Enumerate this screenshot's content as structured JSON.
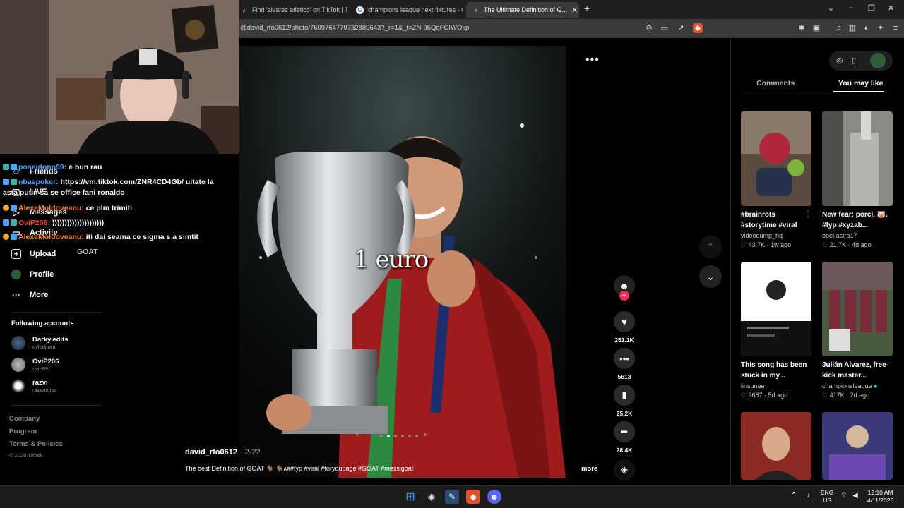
{
  "browser": {
    "tabs": [
      {
        "label": "Find 'alvarez atletico' on TikTok | TikT",
        "icon": "tiktok-icon"
      },
      {
        "label": "champions league next fixtures - Goo",
        "icon": "google-icon"
      },
      {
        "label": "The Ultimate Definition of G...",
        "icon": "tiktok-icon",
        "active": true
      }
    ],
    "url": "@david_rfo0612/photo/7609764779732880643?_r=1&_t=ZN-95QqFCIWOkp"
  },
  "chat": [
    {
      "user": "poseidonn99:",
      "text": " e bun rau",
      "color": "blue"
    },
    {
      "user": "nbaspoker:",
      "text": " https://vm.tiktok.com/ZNR4CD4Gb/ uitate la",
      "color": "blue"
    },
    {
      "user": "",
      "text": "asta putin sa se office fani ronaldo",
      "color": "none"
    },
    {
      "user": "AlexeMoldoveanu:",
      "text": " ce plm trimiti",
      "color": "orange"
    },
    {
      "user": "OviP206:",
      "text": " )))))))))))))))))))))",
      "color": "red"
    },
    {
      "user": "AlexeMoldoveanu:",
      "text": " iti dai seama ce sigma s a simtit",
      "color": "orange"
    },
    {
      "user": "",
      "text": "GOAT",
      "color": "none"
    }
  ],
  "sidebar": {
    "nav": [
      {
        "label": "Friends",
        "icon": "friends-icon"
      },
      {
        "label": "LIVE",
        "icon": "live-icon"
      },
      {
        "label": "Messages",
        "icon": "messages-icon"
      },
      {
        "label": "Activity",
        "icon": "activity-icon"
      },
      {
        "label": "Upload",
        "icon": "upload-icon"
      },
      {
        "label": "Profile",
        "icon": "profile-icon"
      },
      {
        "label": "More",
        "icon": "more-icon"
      }
    ],
    "following_title": "Following accounts",
    "following": [
      {
        "name": "Darky.edits",
        "handle": "ovleditorul"
      },
      {
        "name": "OviP206",
        "handle": "ovip89"
      },
      {
        "name": "razvi",
        "handle": "razvan.rsc"
      }
    ],
    "footer": [
      "Company",
      "Program",
      "Terms & Policies",
      "© 2026 TikTok"
    ]
  },
  "post": {
    "overlay_text": "1 euro",
    "author": "david_rfo0612",
    "date": "· 2-22",
    "description": "The best Definition of GOAT 🐐 🐐ᴀʀ#fyp #viral #foryoupage #GOAT #messigoat",
    "more_label": "more",
    "likes": "251.1K",
    "comments": "5613",
    "saves": "25.2K",
    "shares": "28.4K",
    "slides": 6,
    "active_slide": 1
  },
  "right_panel": {
    "tabs": [
      "Comments",
      "You may like"
    ],
    "active_tab": "You may like",
    "cards": [
      {
        "title": "#brainrots #storytime #viral",
        "channel": "videodump_hq",
        "likes": "43.7K",
        "age": "1w ago"
      },
      {
        "title": "New fear: porci. 🐷. #fyp #xyzab...",
        "channel": "opel.astra17",
        "likes": "21.7K",
        "age": "4d ago"
      },
      {
        "title": "This song has been stuck in my...",
        "channel": "linsunae",
        "likes": "9687",
        "age": "5d ago"
      },
      {
        "title": "Julián Alvarez, free-kick master...",
        "channel": "championsleague",
        "likes": "417K",
        "age": "2d ago",
        "verified": true
      },
      {
        "title": "",
        "channel": "",
        "likes": "",
        "age": ""
      },
      {
        "title": "",
        "channel": "",
        "likes": "",
        "age": ""
      }
    ]
  },
  "taskbar": {
    "lang_top": "ENG",
    "lang_bottom": "US",
    "time": "12:10 AM",
    "date": "4/11/2026"
  }
}
